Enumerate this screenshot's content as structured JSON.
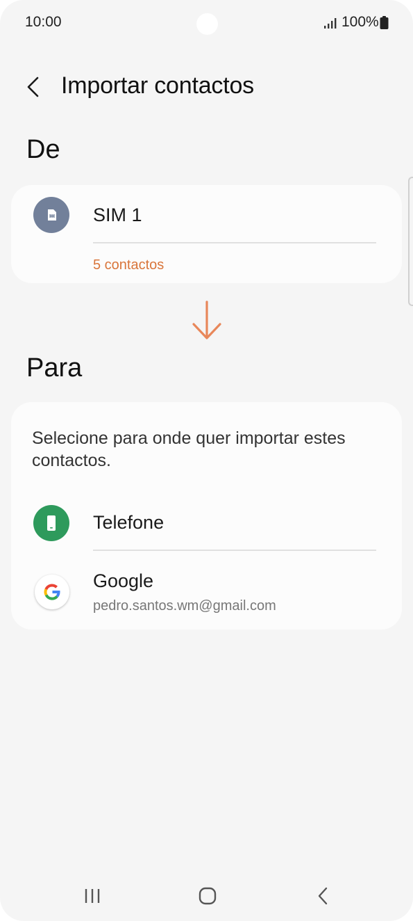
{
  "status_bar": {
    "time": "10:00",
    "battery_percent": "100%",
    "icons": [
      "signal-icon",
      "battery-icon"
    ]
  },
  "header": {
    "title": "Importar contactos",
    "back_icon": "chevron-left-icon"
  },
  "from_section": {
    "title": "De",
    "source": {
      "name": "SIM 1",
      "detail": "5 contactos",
      "icon": "sim-card-icon",
      "detail_color": "#d9753a",
      "icon_bg": "#72809a"
    }
  },
  "arrow_icon": "arrow-down-icon",
  "arrow_color": "#e8875a",
  "to_section": {
    "title": "Para",
    "description": "Selecione para onde quer importar estes contactos.",
    "options": [
      {
        "name": "Telefone",
        "icon": "phone-icon",
        "icon_bg": "#2e9a5c"
      },
      {
        "name": "Google",
        "detail": "pedro.santos.wm@gmail.com",
        "icon": "google-icon"
      }
    ]
  },
  "nav_bar": {
    "buttons": [
      "recent-apps-icon",
      "home-icon",
      "back-icon"
    ]
  }
}
